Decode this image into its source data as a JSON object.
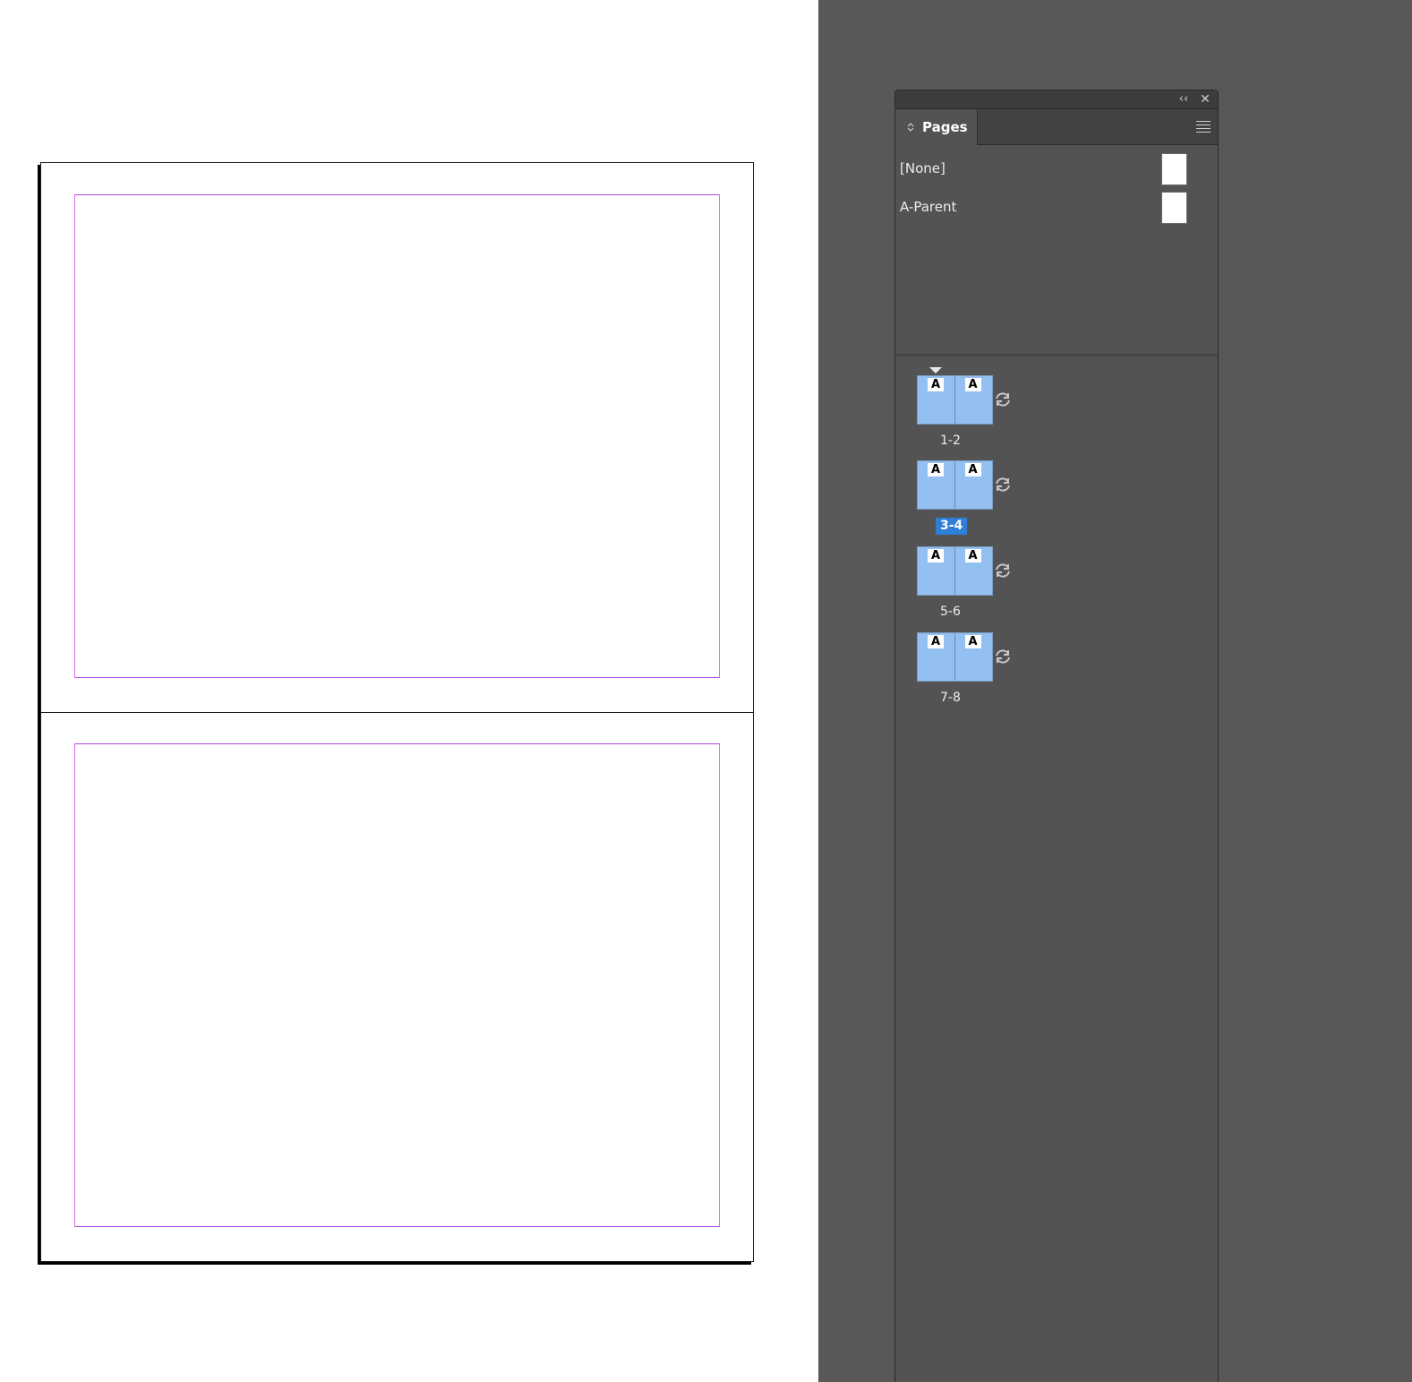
{
  "panel": {
    "tab_label": "Pages",
    "collapse_glyph": "‹‹",
    "close_glyph": "✕",
    "icons": {
      "collapse": "collapse-panel-icon",
      "close": "close-icon",
      "menu": "panel-menu-icon",
      "tab_arrows": "sort-arrows-icon",
      "rotate": "rotate-spread-icon"
    }
  },
  "parents": [
    {
      "label": "[None]"
    },
    {
      "label": "A-Parent"
    }
  ],
  "spreads": [
    {
      "label": "1-2",
      "left_badge": "A",
      "right_badge": "A",
      "selected": false,
      "current": true
    },
    {
      "label": "3-4",
      "left_badge": "A",
      "right_badge": "A",
      "selected": true,
      "current": false
    },
    {
      "label": "5-6",
      "left_badge": "A",
      "right_badge": "A",
      "selected": false,
      "current": false
    },
    {
      "label": "7-8",
      "left_badge": "A",
      "right_badge": "A",
      "selected": false,
      "current": false
    }
  ],
  "colors": {
    "margin_guide": "#b048e0",
    "thumb_fill": "#93c0f0",
    "selection": "#2d7fd8",
    "panel_bg": "#535353",
    "dock_bg": "#585858"
  }
}
